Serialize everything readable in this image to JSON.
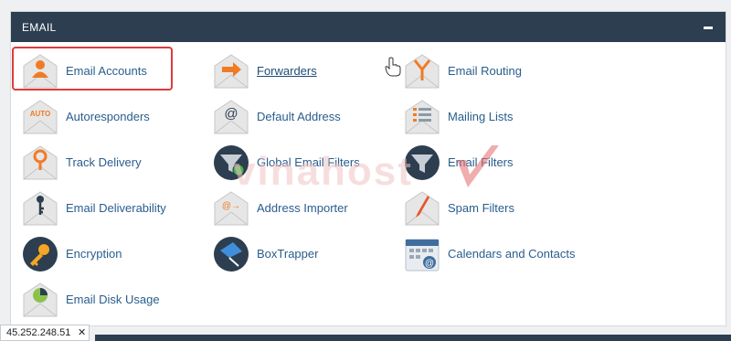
{
  "panel": {
    "title": "EMAIL",
    "collapse_icon": "minus-icon"
  },
  "items": [
    {
      "label": "Email Accounts",
      "icon": "email-accounts-icon"
    },
    {
      "label": "Forwarders",
      "icon": "forwarders-icon"
    },
    {
      "label": "Email Routing",
      "icon": "email-routing-icon"
    },
    {
      "label": "Autoresponders",
      "icon": "autoresponders-icon"
    },
    {
      "label": "Default Address",
      "icon": "default-address-icon"
    },
    {
      "label": "Mailing Lists",
      "icon": "mailing-lists-icon"
    },
    {
      "label": "Track Delivery",
      "icon": "track-delivery-icon"
    },
    {
      "label": "Global Email Filters",
      "icon": "global-email-filters-icon"
    },
    {
      "label": "Email Filters",
      "icon": "email-filters-icon"
    },
    {
      "label": "Email Deliverability",
      "icon": "email-deliverability-icon"
    },
    {
      "label": "Address Importer",
      "icon": "address-importer-icon"
    },
    {
      "label": "Spam Filters",
      "icon": "spam-filters-icon"
    },
    {
      "label": "Encryption",
      "icon": "encryption-icon"
    },
    {
      "label": "BoxTrapper",
      "icon": "boxtrapper-icon"
    },
    {
      "label": "Calendars and Contacts",
      "icon": "calendars-contacts-icon"
    },
    {
      "label": "Email Disk Usage",
      "icon": "email-disk-usage-icon"
    }
  ],
  "icon_text": {
    "autoresponders": "AUTO",
    "default_address": "@",
    "address_importer": "@→"
  },
  "watermark": "vinahost",
  "status_bar": {
    "ip": "45.252.248.51",
    "close": "✕"
  },
  "colors": {
    "header_bg": "#2c3e50",
    "link": "#295d8d",
    "accent_orange": "#f07b24",
    "highlight_border": "#e03a3a"
  }
}
